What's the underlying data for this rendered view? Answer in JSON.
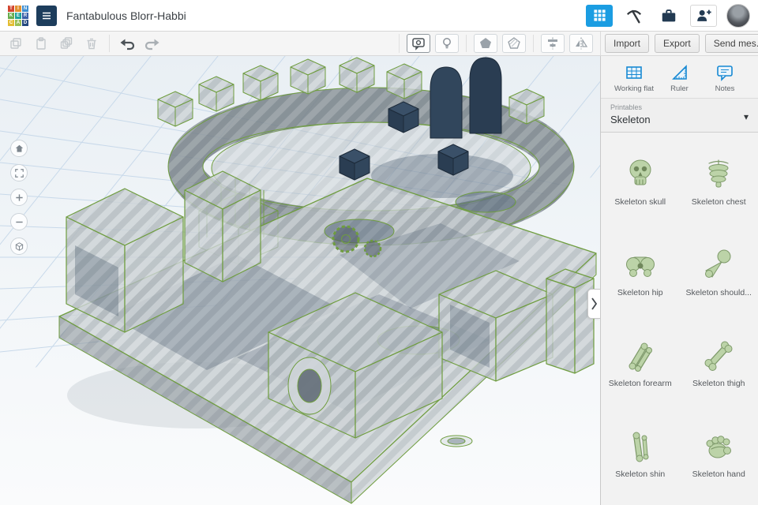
{
  "logo": {
    "letters": [
      "T",
      "I",
      "N",
      "K",
      "E",
      "R",
      "C",
      "A",
      "D"
    ],
    "colors": [
      "#d3452f",
      "#e2902f",
      "#3f8fd2",
      "#67ad4d",
      "#1fa29a",
      "#3a5fa8",
      "#e3bd34",
      "#99bf54",
      "#24497f"
    ]
  },
  "header": {
    "title": "Fantabulous Blorr-Habbi"
  },
  "toolbar": {
    "import": "Import",
    "export": "Export",
    "send": "Send mes..."
  },
  "panel": {
    "helpers": [
      {
        "label": "Working flat"
      },
      {
        "label": "Ruler"
      },
      {
        "label": "Notes"
      }
    ],
    "dropdown": {
      "label": "Printables",
      "value": "Skeleton",
      "chevron": "▾"
    },
    "parts": [
      {
        "label": "Skeleton skull"
      },
      {
        "label": "Skeleton chest"
      },
      {
        "label": "Skeleton hip"
      },
      {
        "label": "Skeleton should..."
      },
      {
        "label": "Skeleton forearm"
      },
      {
        "label": "Skeleton thigh"
      },
      {
        "label": "Skeleton shin"
      },
      {
        "label": "Skeleton hand"
      }
    ]
  },
  "colors": {
    "accent_blue": "#1b9de2",
    "panel_icon_blue": "#1789d3",
    "wireframe_green": "#6f9d3f",
    "navy": "#31465c"
  }
}
